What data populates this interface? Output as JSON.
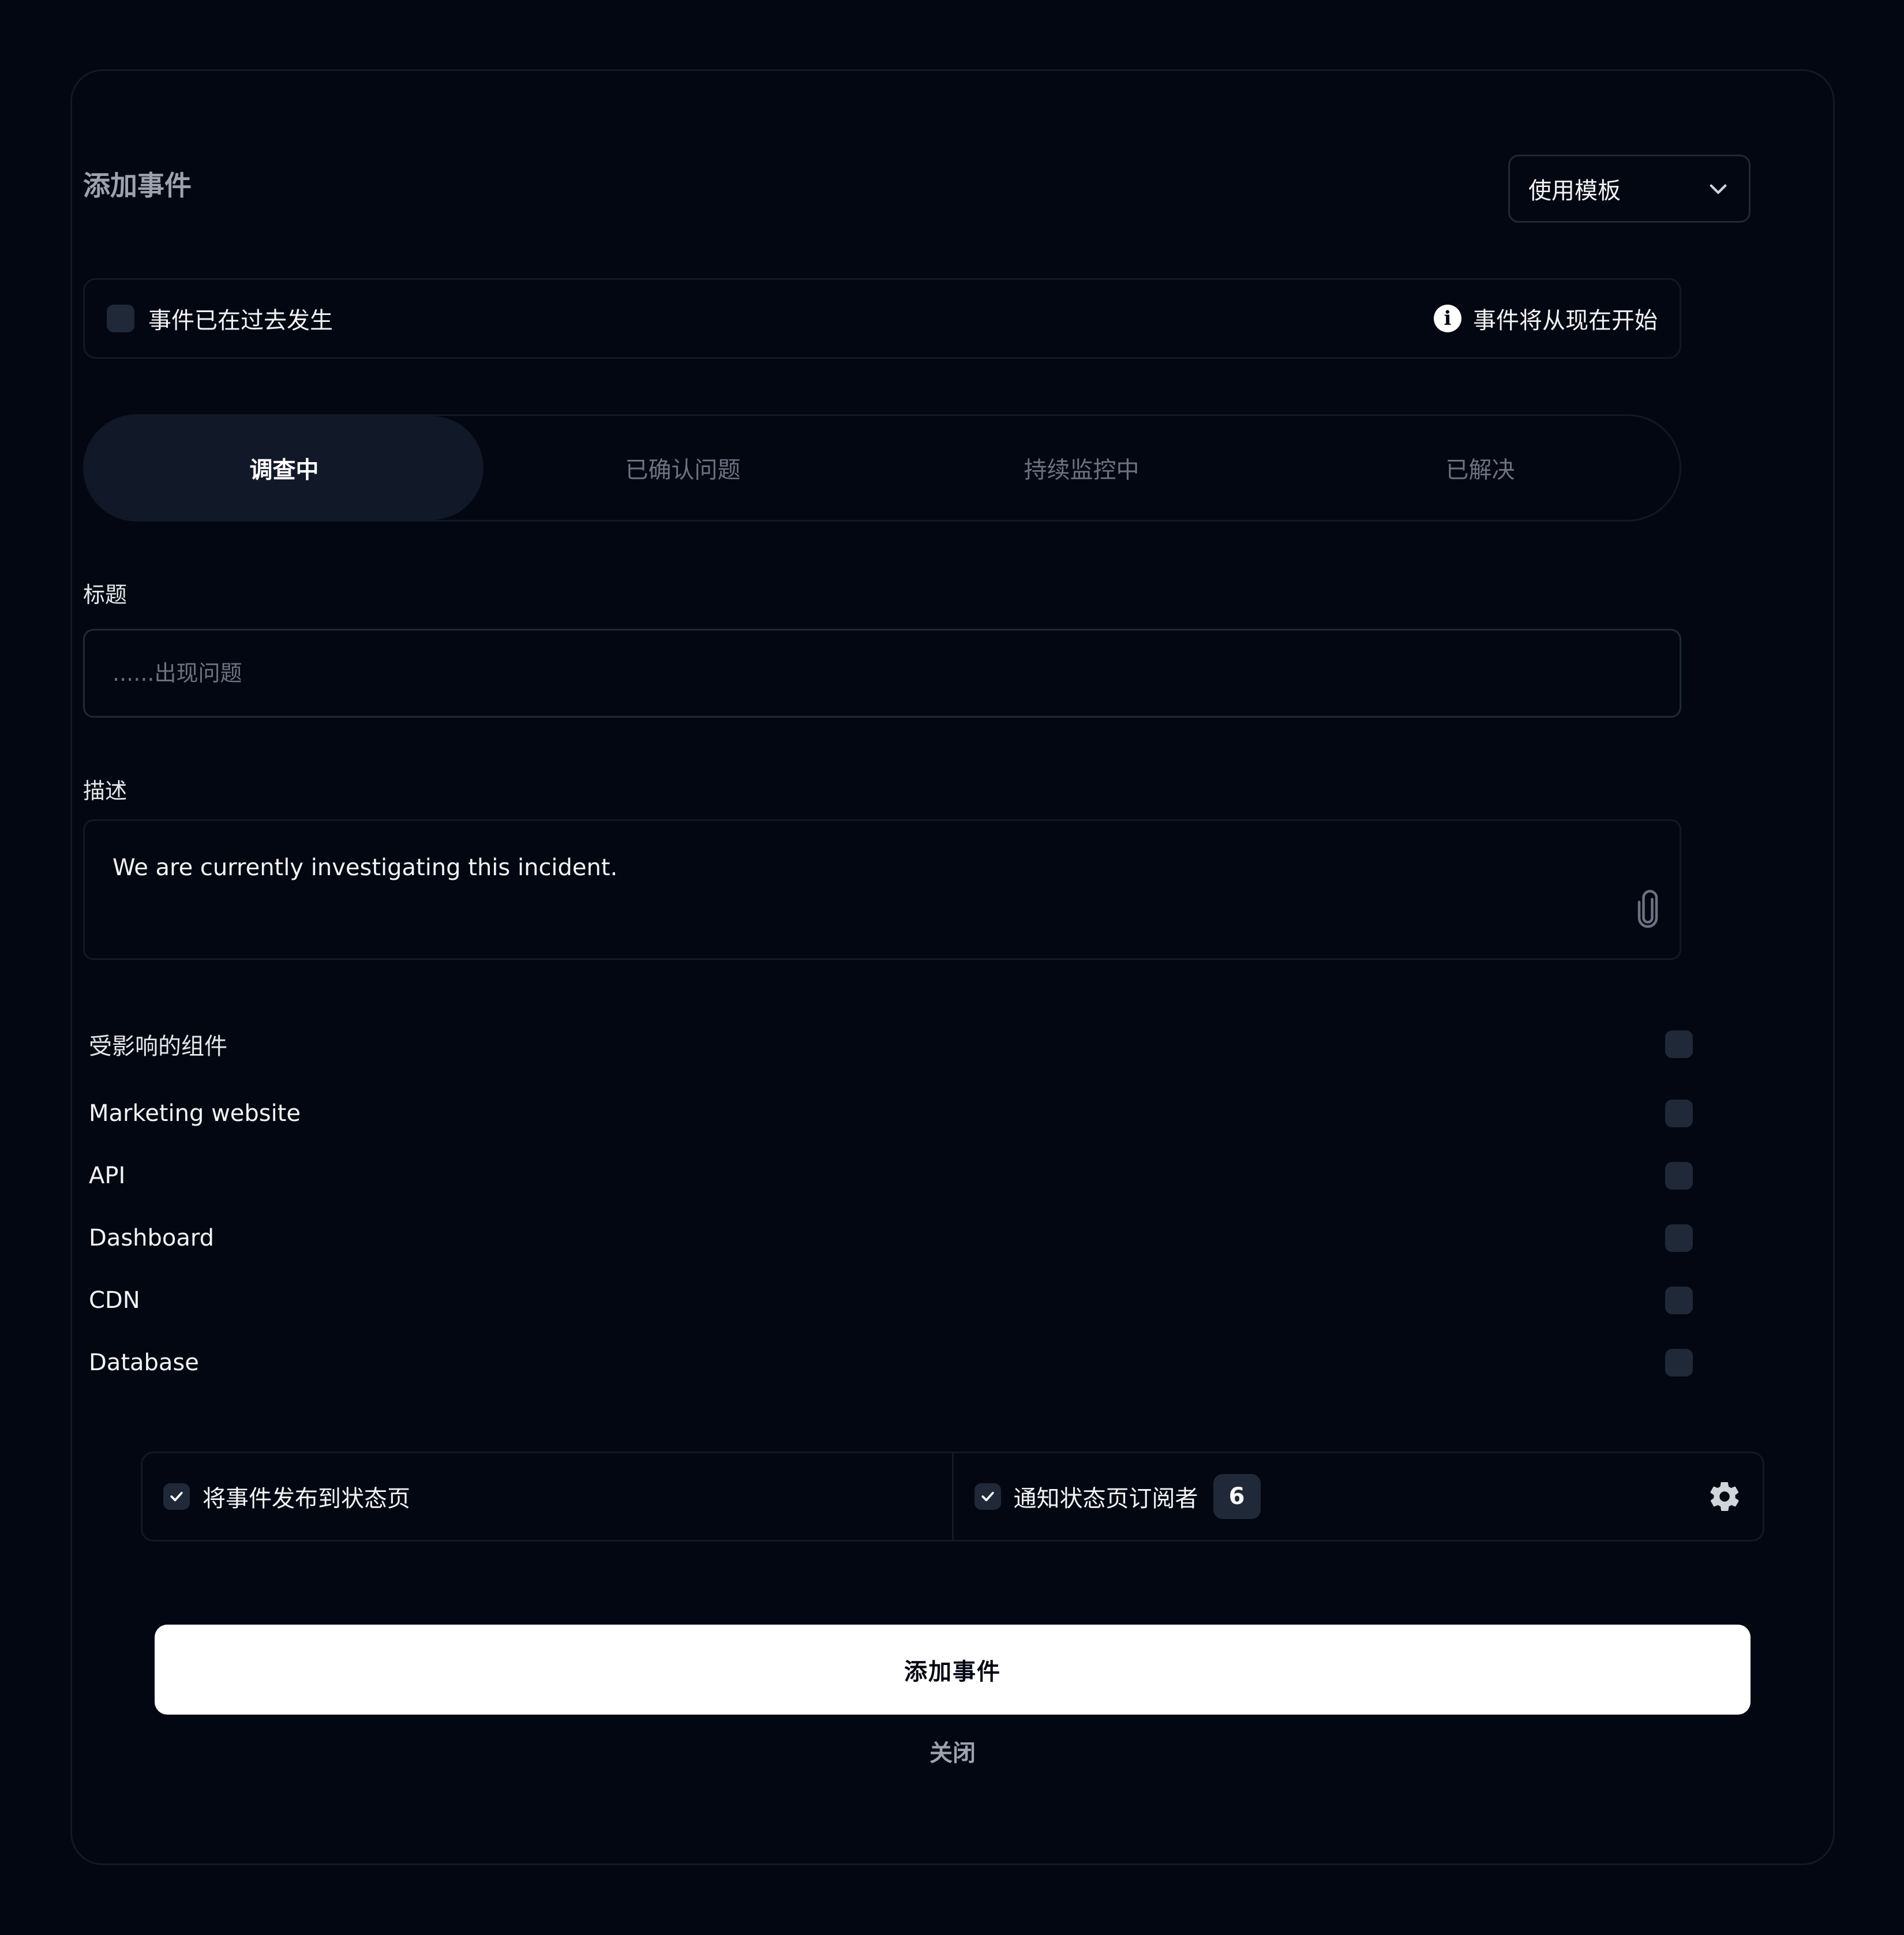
{
  "header": {
    "title": "添加事件",
    "template_select_label": "使用模板"
  },
  "past_event": {
    "toggle_label": "事件已在过去发生",
    "info_text": "事件将从现在开始"
  },
  "status_tabs": [
    {
      "label": "调查中",
      "active": true
    },
    {
      "label": "已确认问题",
      "active": false
    },
    {
      "label": "持续监控中",
      "active": false
    },
    {
      "label": "已解决",
      "active": false
    }
  ],
  "title_field": {
    "label": "标题",
    "placeholder": "......出现问题",
    "value": ""
  },
  "description_field": {
    "label": "描述",
    "value": "We are currently investigating this incident."
  },
  "components": {
    "header": "受影响的组件",
    "items": [
      {
        "label": "Marketing website"
      },
      {
        "label": "API"
      },
      {
        "label": "Dashboard"
      },
      {
        "label": "CDN"
      },
      {
        "label": "Database"
      }
    ]
  },
  "notify": {
    "publish_label": "将事件发布到状态页",
    "publish_checked": true,
    "subscribers_label": "通知状态页订阅者",
    "subscribers_checked": true,
    "subscriber_count": "6"
  },
  "actions": {
    "submit_label": "添加事件",
    "close_label": "关闭"
  },
  "colors": {
    "background": "#030712",
    "border": "#111827",
    "active_tab": "#111827",
    "primary_button": "#ffffff"
  }
}
